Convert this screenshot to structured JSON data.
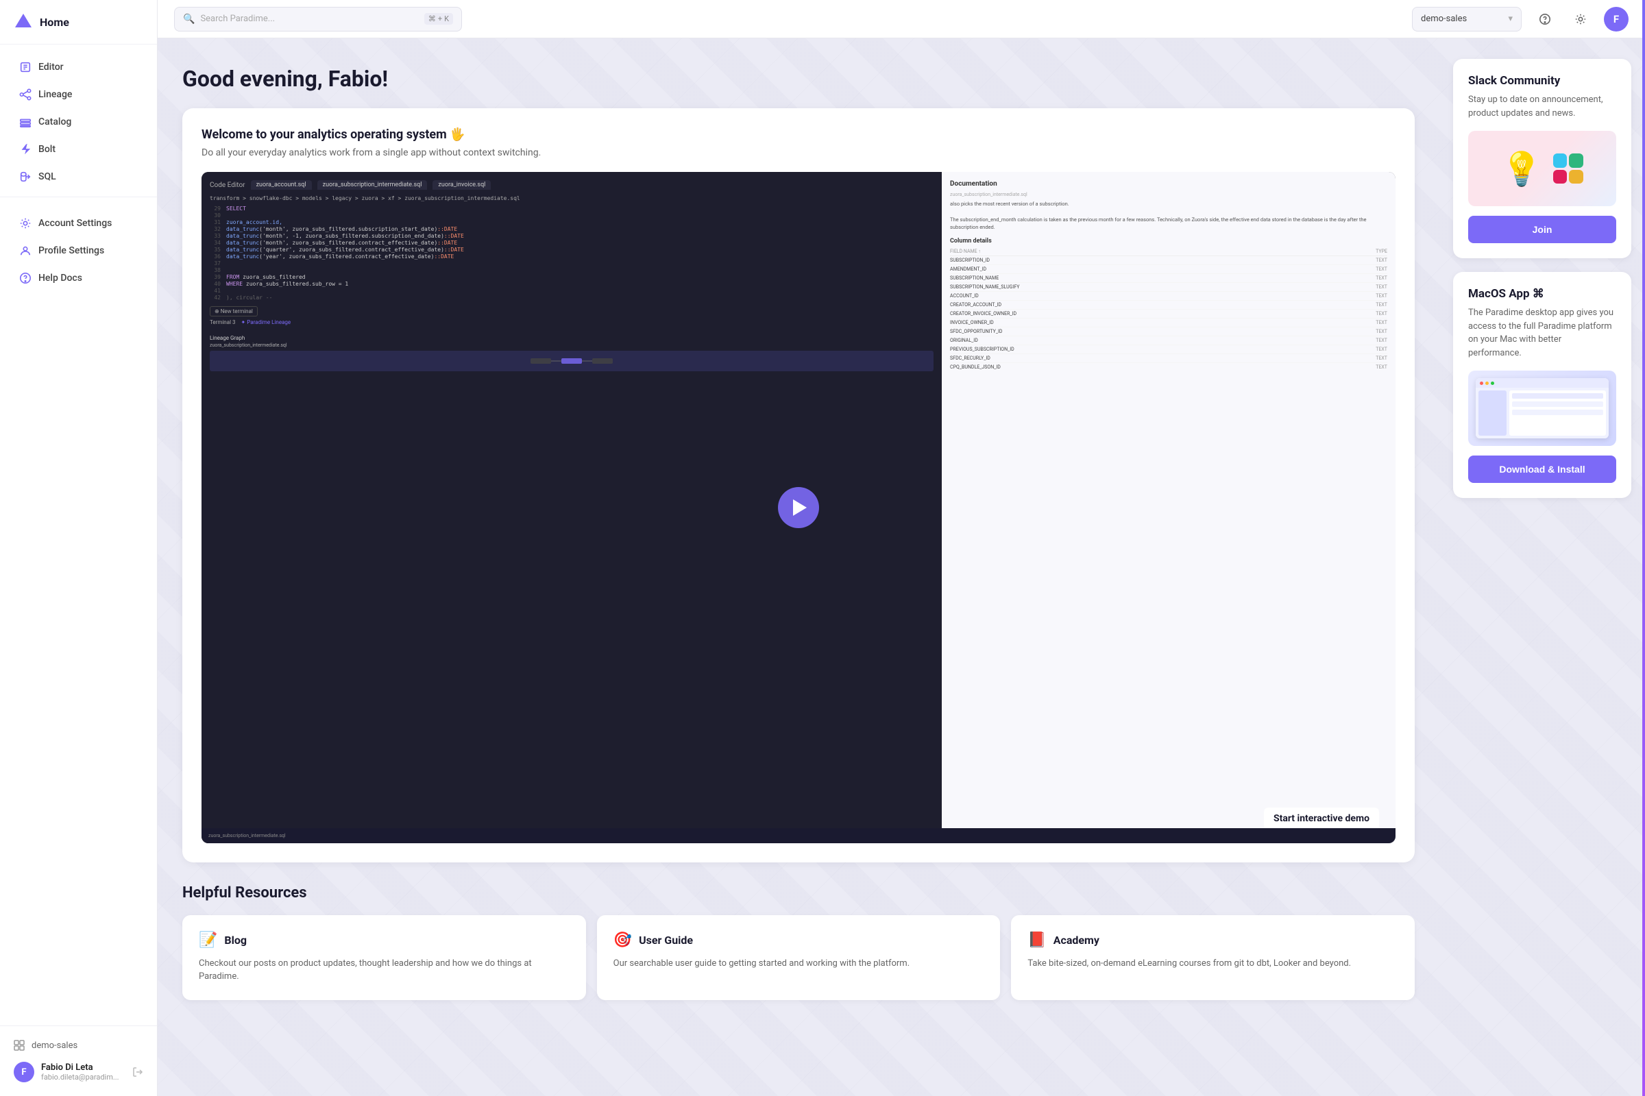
{
  "app": {
    "logo_text": "Home",
    "logo_letter": "▲"
  },
  "sidebar": {
    "nav_items": [
      {
        "id": "editor",
        "label": "Editor",
        "icon": "editor"
      },
      {
        "id": "lineage",
        "label": "Lineage",
        "icon": "lineage"
      },
      {
        "id": "catalog",
        "label": "Catalog",
        "icon": "catalog"
      },
      {
        "id": "bolt",
        "label": "Bolt",
        "icon": "bolt"
      },
      {
        "id": "sql",
        "label": "SQL",
        "icon": "sql"
      }
    ],
    "settings_items": [
      {
        "id": "account-settings",
        "label": "Account Settings",
        "icon": "settings"
      },
      {
        "id": "profile-settings",
        "label": "Profile Settings",
        "icon": "profile"
      },
      {
        "id": "help-docs",
        "label": "Help Docs",
        "icon": "help"
      }
    ],
    "workspace": "demo-sales",
    "user": {
      "name": "Fabio Di Leta",
      "email": "fabio.dileta@paradim...",
      "avatar": "F"
    }
  },
  "topbar": {
    "search_placeholder": "Search Paradime...",
    "search_shortcut_cmd": "⌘",
    "search_shortcut_key": "K",
    "workspace_label": "demo-sales"
  },
  "main": {
    "greeting": "Good evening, Fabio!",
    "welcome_title": "Welcome to your analytics operating system 🖐",
    "welcome_desc": "Do all your everyday analytics work from a single app without context switching.",
    "demo_label": "Start interactive demo",
    "resources_title": "Helpful Resources",
    "resources": [
      {
        "icon": "📝",
        "title": "Blog",
        "desc": "Checkout our posts on product updates, thought leadership and how we do things at Paradime."
      },
      {
        "icon": "🎯",
        "title": "User Guide",
        "desc": "Our searchable user guide to getting started and working with the platform."
      },
      {
        "icon": "📕",
        "title": "Academy",
        "desc": "Take bite-sized, on-demand eLearning courses from git to dbt, Looker and beyond."
      }
    ]
  },
  "right_sidebar": {
    "slack": {
      "title": "Slack Community",
      "desc": "Stay up to date on announcement, product updates and news.",
      "cta": "Join"
    },
    "macos": {
      "title": "MacOS App ⌘",
      "desc": "The Paradime desktop app gives you access to the full Paradime platform on your Mac with better performance.",
      "cta": "Download & Install"
    }
  }
}
